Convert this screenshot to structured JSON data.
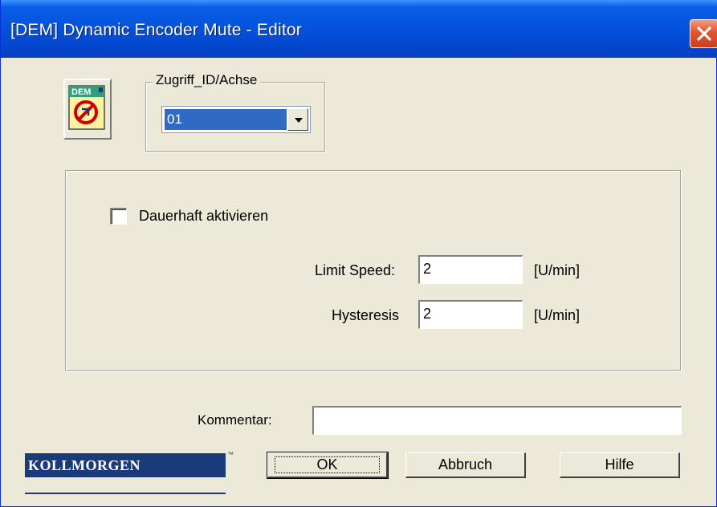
{
  "window": {
    "title": "[DEM] Dynamic Encoder Mute - Editor"
  },
  "icons": {
    "module_icon": "dem-icon",
    "module_icon_text": "DEM",
    "close": "close-icon",
    "dropdown": "chevron-down-icon"
  },
  "access_group": {
    "legend": "Zugriff_ID/Achse",
    "selected": "01"
  },
  "settings": {
    "permanent_label": "Dauerhaft aktivieren",
    "permanent_checked": false,
    "limit_speed_label": "Limit Speed:",
    "limit_speed_value": "2",
    "limit_speed_unit": "[U/min]",
    "hysteresis_label": "Hysteresis",
    "hysteresis_value": "2",
    "hysteresis_unit": "[U/min]"
  },
  "comment": {
    "label": "Kommentar:",
    "value": ""
  },
  "buttons": {
    "ok": "OK",
    "cancel": "Abbruch",
    "help": "Hilfe"
  },
  "brand": {
    "name": "KOLLMORGEN",
    "tm": "™",
    "color": "#1b3a7a"
  },
  "colors": {
    "titlebar": "#0553dc",
    "selection": "#316ac5",
    "dialog_bg": "#ece9d8",
    "close_button": "#e3532b"
  }
}
